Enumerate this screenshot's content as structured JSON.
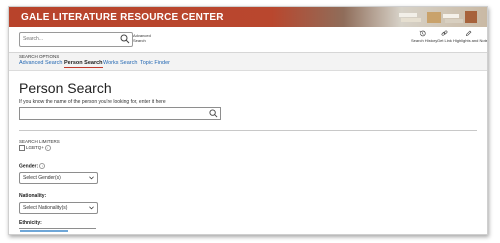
{
  "banner": {
    "title": "GALE LITERATURE RESOURCE CENTER"
  },
  "topbar": {
    "search_placeholder": "Search...",
    "advanced_link": "Advanced Search",
    "tools": [
      {
        "label": "Search History",
        "icon": "history-icon"
      },
      {
        "label": "Get Link",
        "icon": "link-icon"
      },
      {
        "label": "Highlights and Notes",
        "icon": "pencil-icon"
      }
    ]
  },
  "search_options": {
    "heading": "SEARCH OPTIONS",
    "tabs": [
      {
        "label": "Advanced Search",
        "active": false
      },
      {
        "label": "Person Search",
        "active": true
      },
      {
        "label": "Works Search",
        "active": false
      },
      {
        "label": "Topic Finder",
        "active": false
      }
    ]
  },
  "main": {
    "title": "Person Search",
    "subtitle": "If you know the name of the person you're looking for, enter it here",
    "search_value": ""
  },
  "limiters": {
    "heading": "SEARCH LIMITERS",
    "lgbtq_label": "LGBTQ+",
    "gender": {
      "label": "Gender:",
      "selected": "Select Gender(s)"
    },
    "nationality": {
      "label": "Nationality:",
      "selected": "Select Nationality(s)"
    },
    "ethnicity": {
      "label": "Ethnicity:"
    }
  },
  "colors": {
    "banner": "#b8432b",
    "link": "#2468b3",
    "active_underline": "#c0392b"
  }
}
